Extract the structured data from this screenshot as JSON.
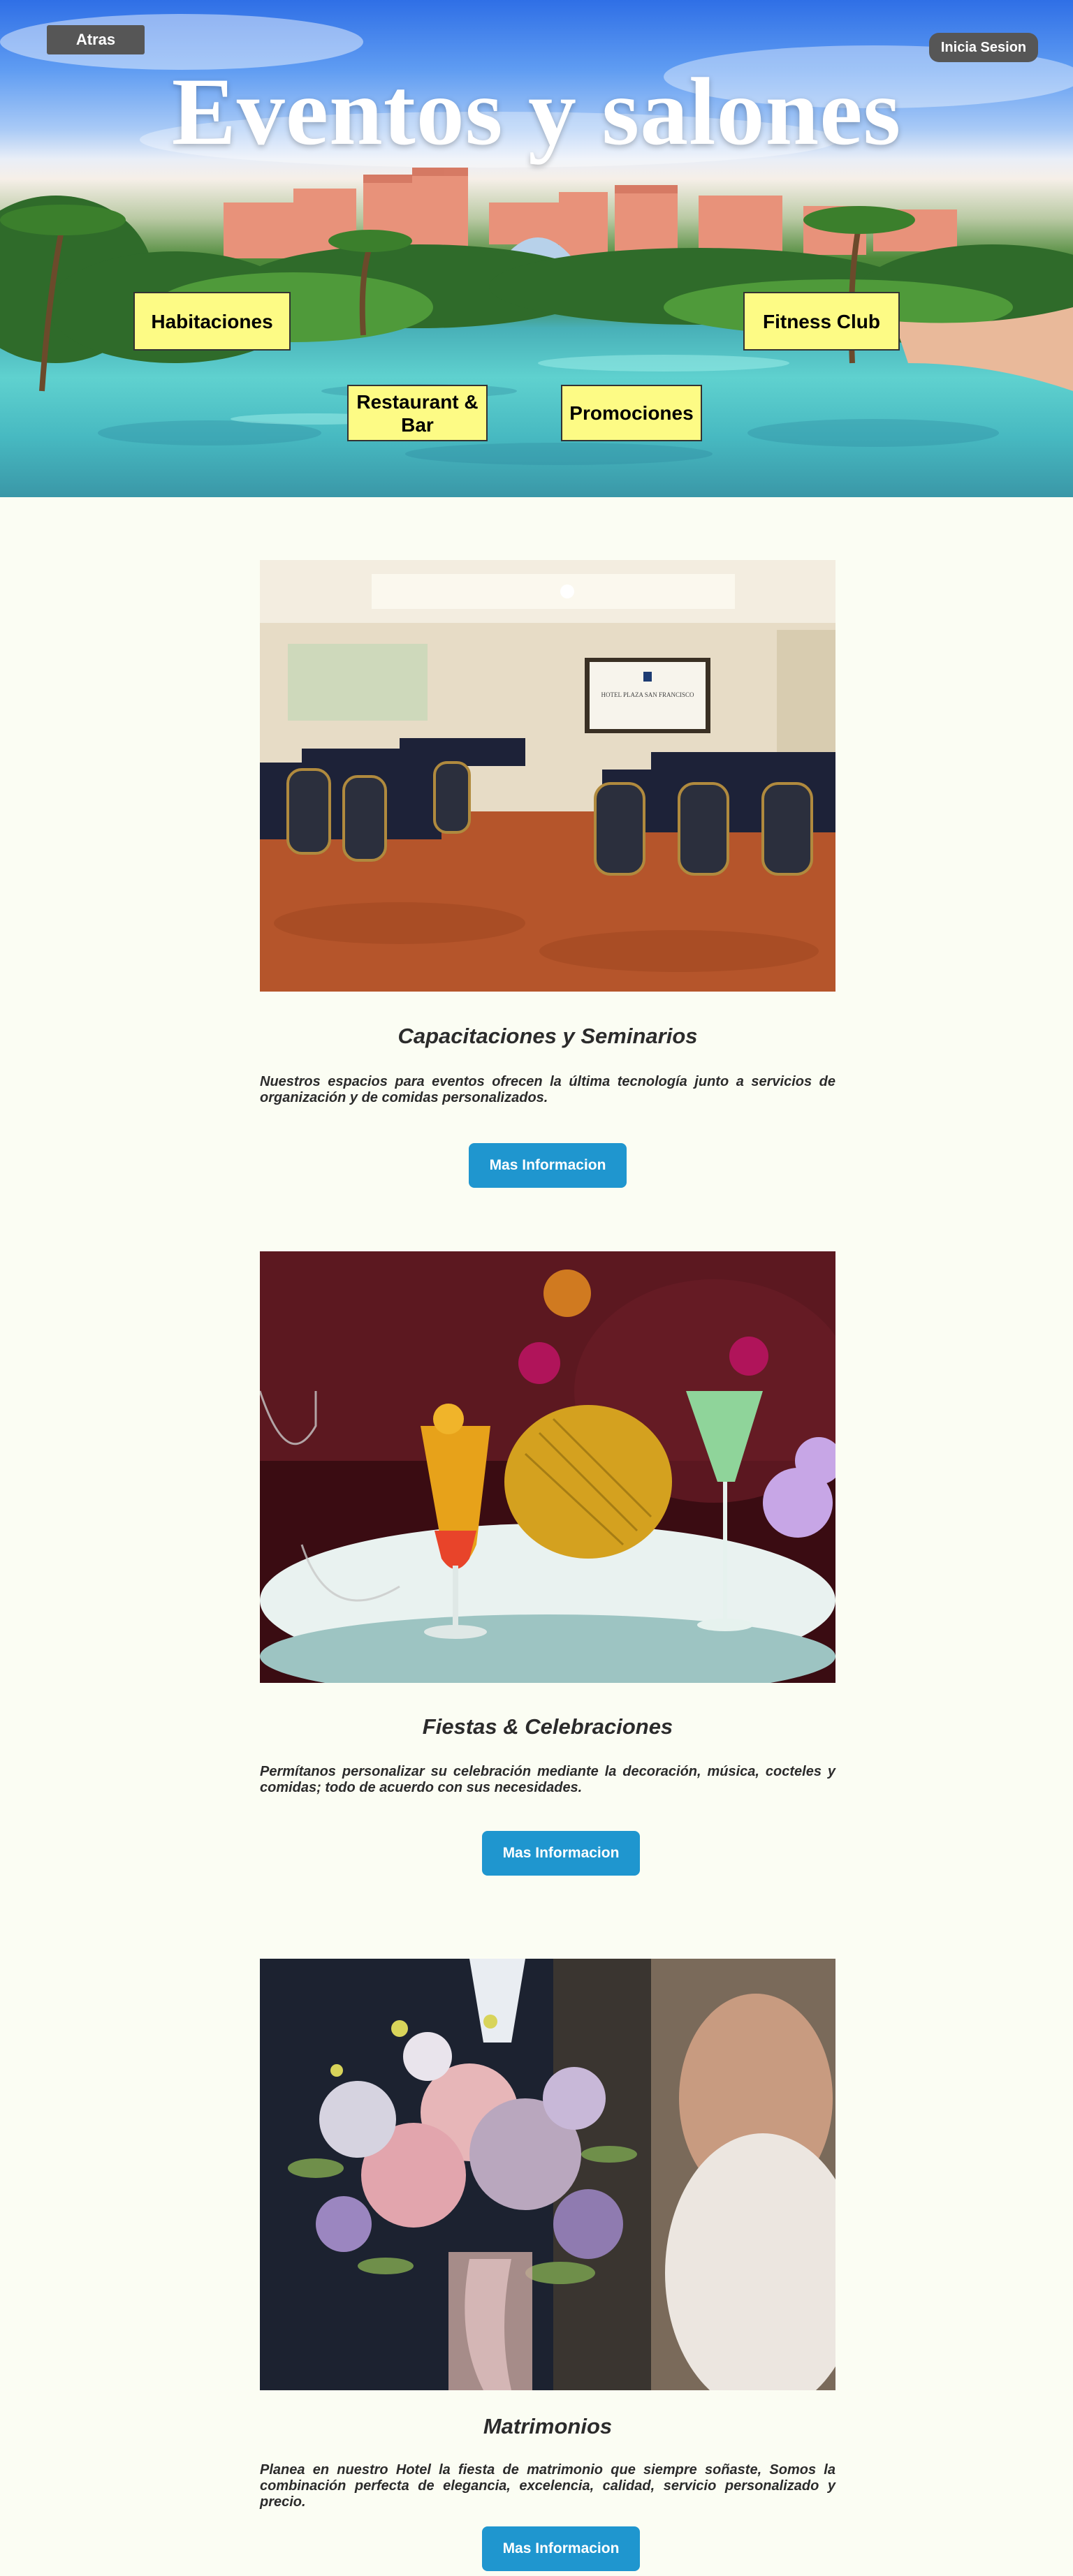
{
  "hero": {
    "title": "Eventos y salones",
    "back_label": "Atras",
    "login_label": "Inicia Sesion",
    "nav": {
      "habitaciones": "Habitaciones",
      "fitness": "Fitness Club",
      "restaurant": "Restaurant & Bar",
      "promociones": "Promociones"
    }
  },
  "sections": [
    {
      "title": "Capacitaciones y Seminarios",
      "text": "Nuestros espacios para eventos ofrecen la última tecnología junto a servicios de organización y de comidas personalizados.",
      "button": "Mas Informacion",
      "screen_text": "HOTEL PLAZA SAN FRANCISCO"
    },
    {
      "title": "Fiestas & Celebraciones",
      "text": "Permítanos personalizar su celebración mediante la decoración, música, cocteles y comidas; todo de acuerdo con sus necesidades.",
      "button": "Mas Informacion"
    },
    {
      "title": "Matrimonios",
      "text": "Planea en nuestro Hotel la fiesta de matrimonio que siempre soñaste, Somos la combinación perfecta de elegancia, excelencia, calidad, servicio personalizado y precio.",
      "button": "Mas Informacion"
    }
  ],
  "colors": {
    "page_bg": "#fbfdf3",
    "nav_yellow": "#fdfb85",
    "info_blue": "#1f96cf",
    "dark_button": "#565656"
  }
}
